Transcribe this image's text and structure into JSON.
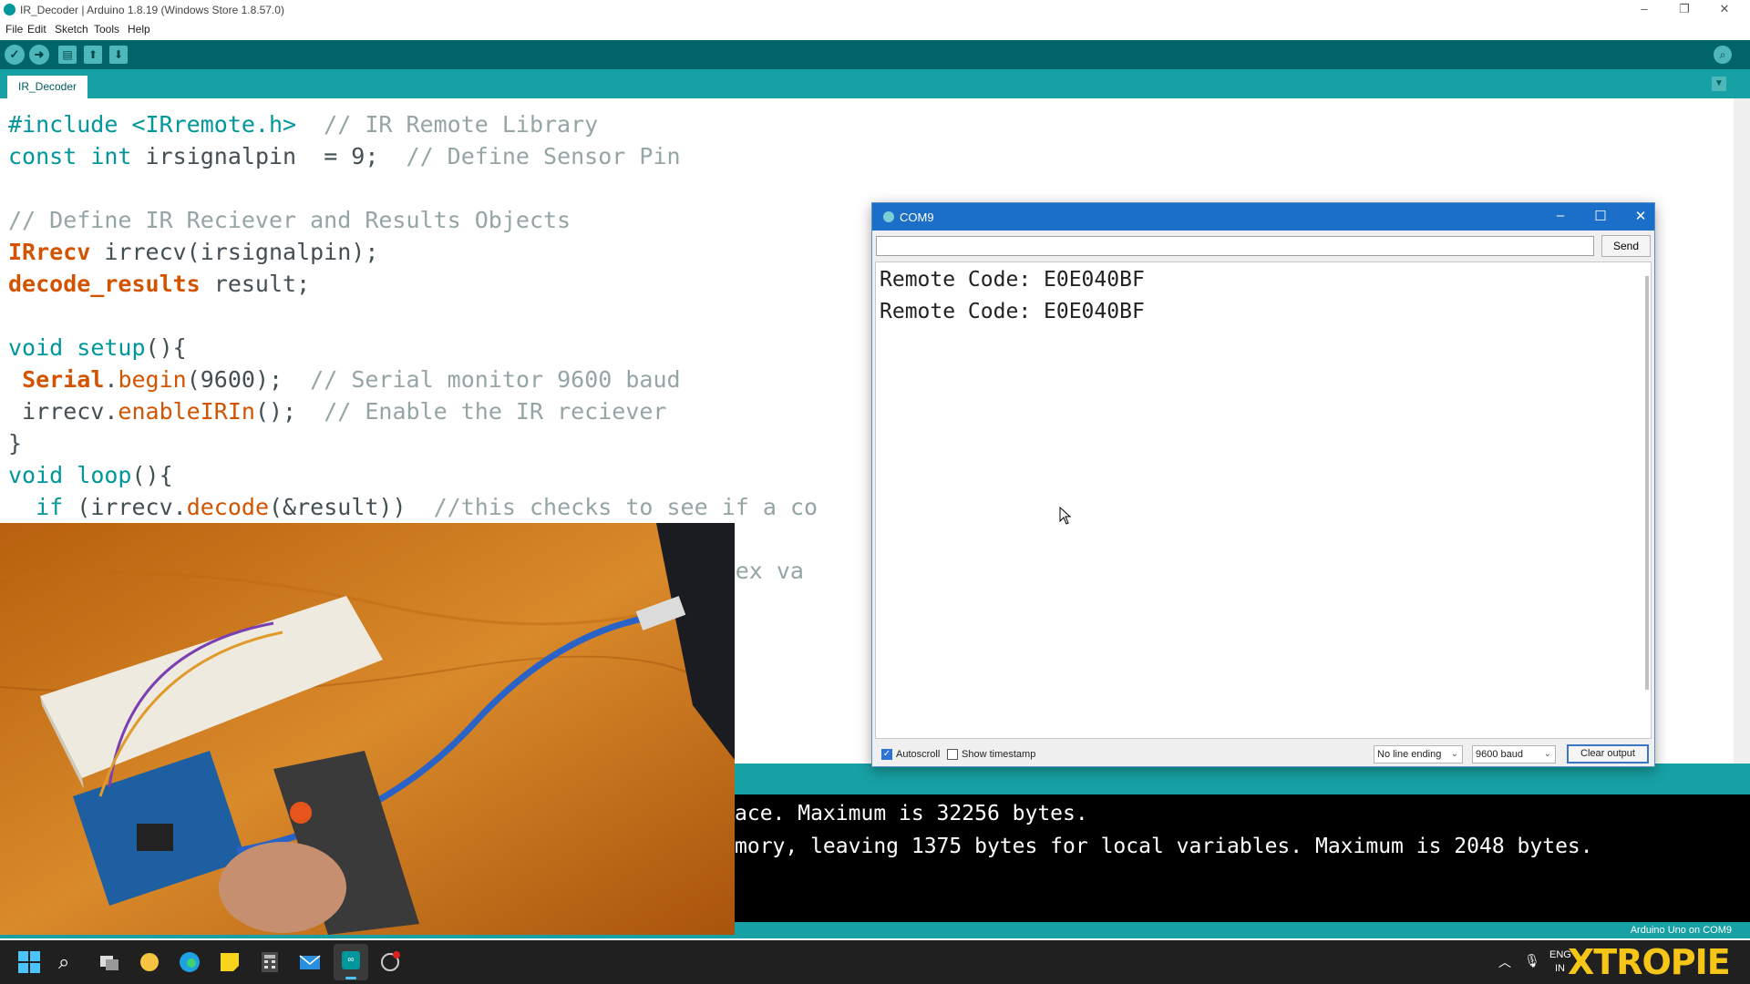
{
  "window": {
    "title": "IR_Decoder | Arduino 1.8.19 (Windows Store 1.8.57.0)"
  },
  "menu": [
    "File",
    "Edit",
    "Sketch",
    "Tools",
    "Help"
  ],
  "tab": {
    "label": "IR_Decoder"
  },
  "code": [
    [
      {
        "t": "#include <IRremote.h>",
        "c": "kw"
      },
      {
        "t": "  // IR Remote Library",
        "c": "cm"
      }
    ],
    [
      {
        "t": "const",
        "c": "kw"
      },
      {
        "t": " "
      },
      {
        "t": "int",
        "c": "kw"
      },
      {
        "t": " irsignalpin  = 9;  "
      },
      {
        "t": "// Define Sensor Pin",
        "c": "cm"
      }
    ],
    [],
    [
      {
        "t": "// Define IR Reciever and Results Objects",
        "c": "cm"
      }
    ],
    [
      {
        "t": "IRrecv",
        "c": "ty"
      },
      {
        "t": " irrecv(irsignalpin);"
      }
    ],
    [
      {
        "t": "decode_results",
        "c": "ty"
      },
      {
        "t": " result;"
      }
    ],
    [],
    [
      {
        "t": "void",
        "c": "kw"
      },
      {
        "t": " "
      },
      {
        "t": "setup",
        "c": "kw"
      },
      {
        "t": "(){"
      }
    ],
    [
      {
        "t": " "
      },
      {
        "t": "Serial",
        "c": "ty"
      },
      {
        "t": "."
      },
      {
        "t": "begin",
        "c": "fn"
      },
      {
        "t": "(9600);  "
      },
      {
        "t": "// Serial monitor 9600 baud",
        "c": "cm"
      }
    ],
    [
      {
        "t": " irrecv."
      },
      {
        "t": "enableIRIn",
        "c": "fn"
      },
      {
        "t": "();  "
      },
      {
        "t": "// Enable the IR reciever",
        "c": "cm"
      }
    ],
    [
      {
        "t": "}"
      }
    ],
    [
      {
        "t": "void",
        "c": "kw"
      },
      {
        "t": " "
      },
      {
        "t": "loop",
        "c": "kw"
      },
      {
        "t": "(){"
      }
    ],
    [
      {
        "t": "  "
      },
      {
        "t": "if",
        "c": "kw"
      },
      {
        "t": " (irrecv."
      },
      {
        "t": "decode",
        "c": "fn"
      },
      {
        "t": "(&result))  "
      },
      {
        "t": "//this checks to see if a co",
        "c": "cm"
      }
    ],
    [],
    [
      {
        "t": "                                                 "
      },
      {
        "t": "he hex va",
        "c": "cm"
      }
    ]
  ],
  "serial": {
    "title": "COM9",
    "input_value": "",
    "send_label": "Send",
    "output": [
      "Remote Code: E0E040BF",
      "Remote Code: E0E040BF"
    ],
    "autoscroll_label": "Autoscroll",
    "autoscroll_checked": true,
    "timestamp_label": "Show timestamp",
    "timestamp_checked": false,
    "line_ending": "No line ending",
    "baud": "9600 baud",
    "clear_label": "Clear output"
  },
  "console": {
    "lines": [
      "ace. Maximum is 32256 bytes.",
      "mory, leaving 1375 bytes for local variables. Maximum is 2048 bytes."
    ]
  },
  "status": {
    "board": "Arduino Uno on COM9"
  },
  "tray": {
    "lang1": "ENG",
    "lang2": "IN"
  },
  "watermark": "XTROPIE",
  "colors": {
    "teal_dark": "#006468",
    "teal": "#17a1a5",
    "keyword": "#00979c",
    "type": "#d35400",
    "comment": "#95a5a6",
    "taskbar": "#202020"
  }
}
